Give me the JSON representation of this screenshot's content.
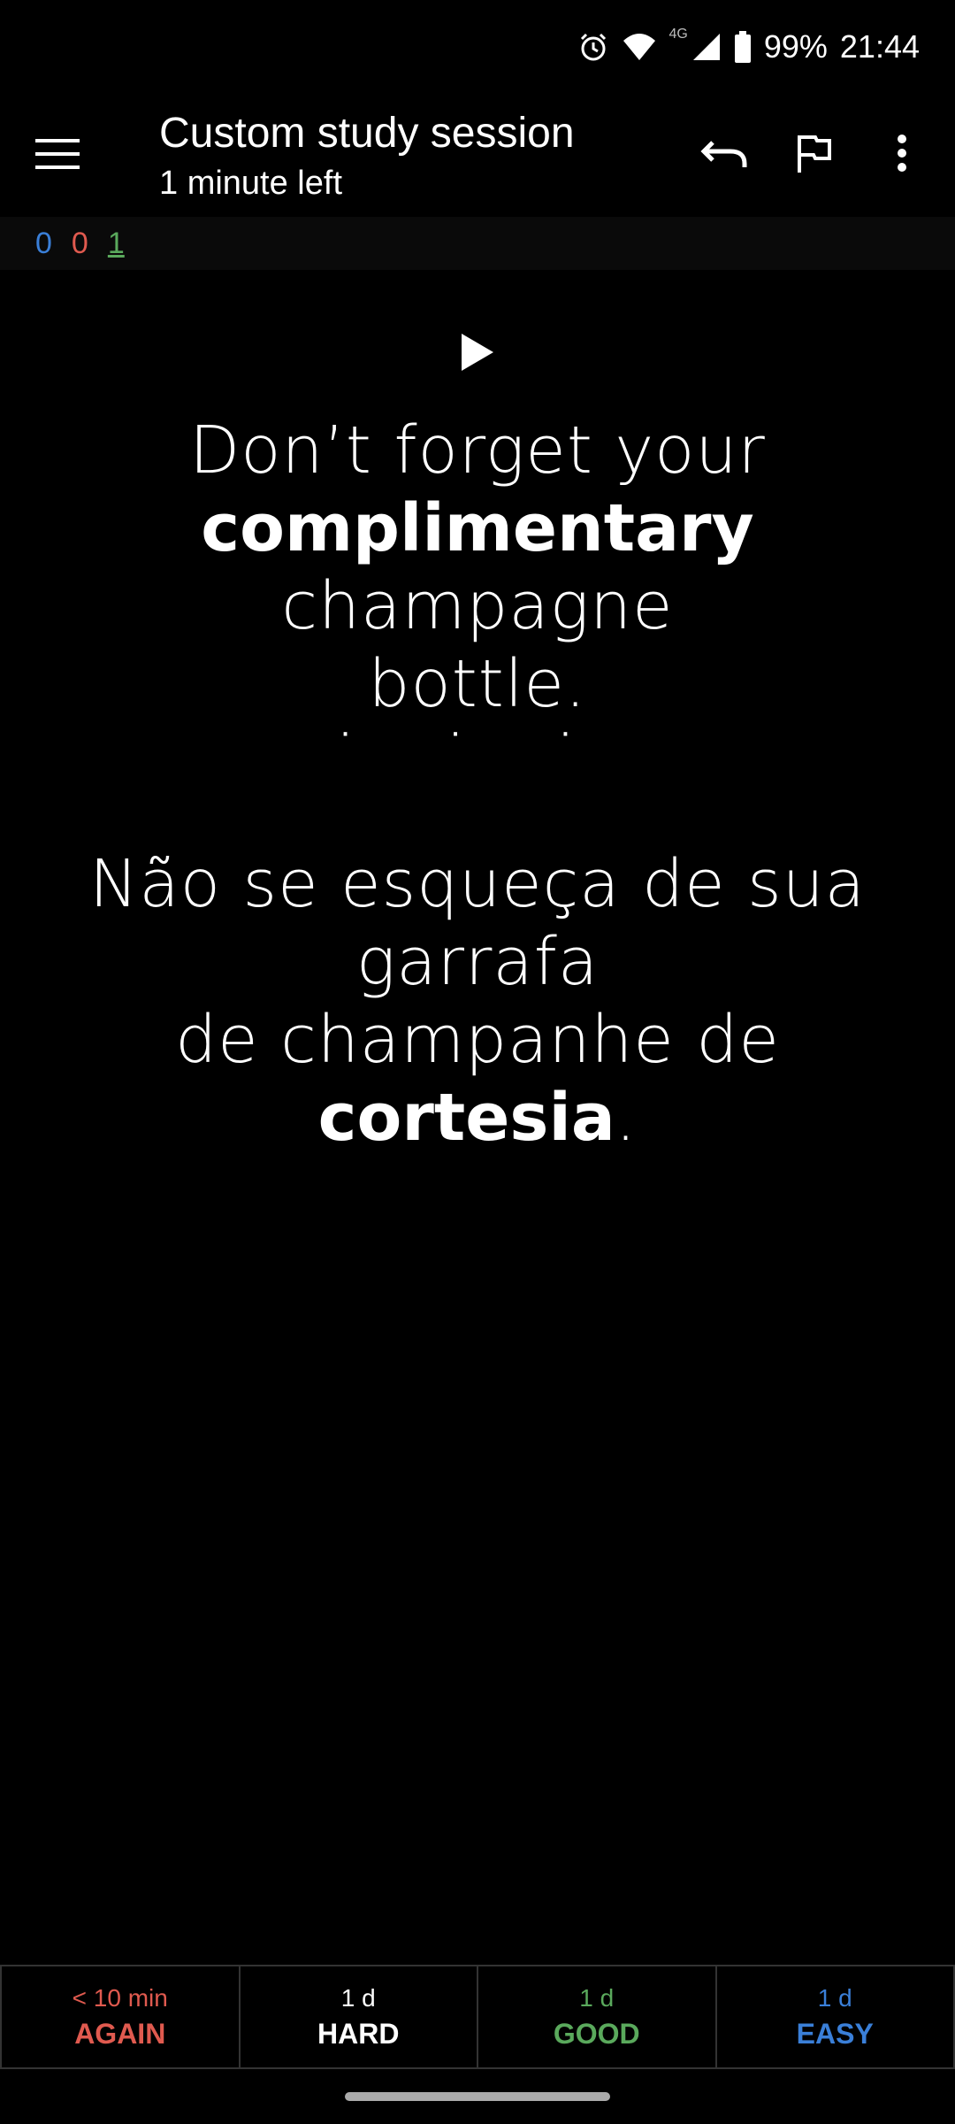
{
  "status_bar": {
    "network": "4G",
    "battery": "99%",
    "time": "21:44",
    "icons": [
      "alarm-icon",
      "wifi-icon",
      "signal-icon",
      "battery-icon"
    ]
  },
  "toolbar": {
    "title": "Custom study session",
    "subtitle": "1 minute left",
    "icons": [
      "menu-icon",
      "undo-icon",
      "flag-icon",
      "more-vert-icon"
    ]
  },
  "counts": {
    "new": "0",
    "learning": "0",
    "review": "1"
  },
  "card": {
    "question": {
      "line1": "Don’t forget your",
      "bold": "complimentary",
      "rest": " champagne",
      "line3": "bottle."
    },
    "separator": "· · ·",
    "answer": {
      "line1": "Não se esqueça de sua garrafa",
      "line2_pre": "de champanhe de ",
      "bold": "cortesia",
      "end": "."
    }
  },
  "answer_buttons": [
    {
      "time": "< 10 min",
      "label": "AGAIN"
    },
    {
      "time": "1 d",
      "label": "HARD"
    },
    {
      "time": "1 d",
      "label": "GOOD"
    },
    {
      "time": "1 d",
      "label": "EASY"
    }
  ],
  "colors": {
    "again": "#e05a4f",
    "good": "#5aa95c",
    "easy": "#3a7fd8",
    "background": "#000000"
  }
}
